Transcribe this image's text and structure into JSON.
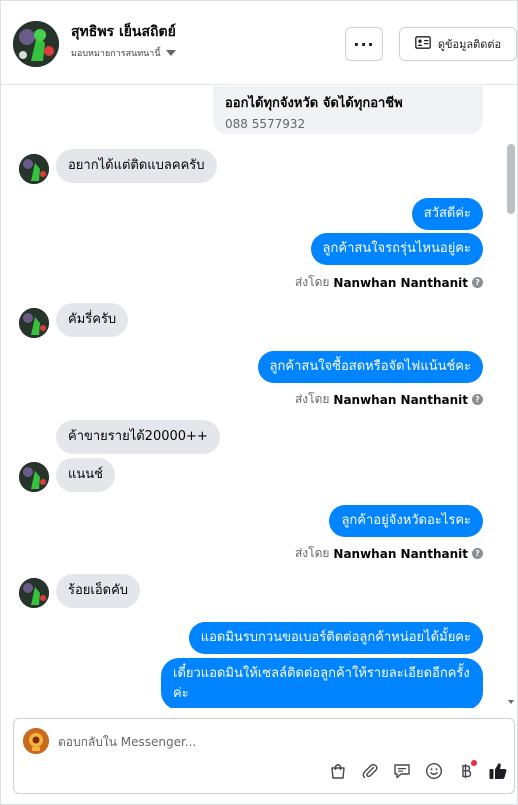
{
  "header": {
    "contact_name": "สุทธิพร เย็นสถิตย์",
    "assign_label": "มอบหมายการสนทนานี้",
    "more_label": "···",
    "contact_info_label": "ดูข้อมูลติดต่อ"
  },
  "conversation": {
    "top_card": {
      "title": "ออกได้ทุกจังหวัด จัดได้ทุกอาชีพ",
      "phone": "088 5577932"
    },
    "messages": {
      "m1": "อยากได้แต่ติดแบลคครับ",
      "m2": "สวัสดีค่ะ",
      "m3": "ลูกค้าสนใจรถรุ่นไหนอยู่คะ",
      "m4": "คัมรี่ครับ",
      "m5": "ลูกค้าสนใจซื้อสดหรือจัดไฟแน้นช์คะ",
      "m6": "ค้าขายรายได้20000++",
      "m7": "แนนช์",
      "m8": "ลูกค้าอยู่จังหวัดอะไรคะ",
      "m9": "ร้อยเอ็ดคับ",
      "m10": "แอดมินรบกวนขอเบอร์ติดต่อลูกค้าหน่อยได้มั้ยคะ",
      "m11": "เดี๋ยวแอดมินให้เซลล์ติดต่อลูกค้าให้รายละเอียดอีกครั้งค่ะ"
    },
    "sent_by_prefix": "ส่งโดย",
    "agent_name": "Nanwhan Nanthanit",
    "help_mark": "?"
  },
  "composer": {
    "placeholder": "ตอบกลับใน Messenger...",
    "icons": [
      "shopping-bag-icon",
      "attachment-icon",
      "saved-reply-icon",
      "emoji-icon",
      "baht-icon",
      "like-icon"
    ]
  },
  "colors": {
    "outgoing_bubble": "#0084ff",
    "incoming_bubble": "#e4e6eb",
    "notification_dot": "#f02849"
  }
}
